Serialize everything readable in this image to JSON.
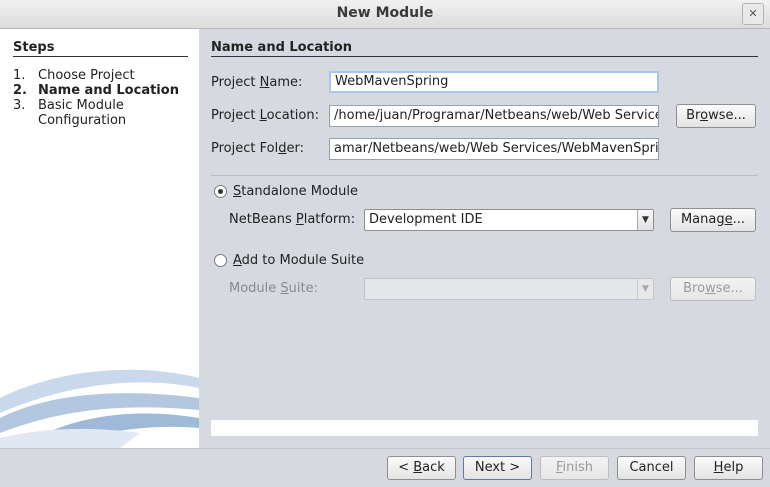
{
  "window": {
    "title": "New Module",
    "close_glyph": "✕"
  },
  "steps": {
    "title": "Steps",
    "items": [
      {
        "num": "1.",
        "label": "Choose Project"
      },
      {
        "num": "2.",
        "label": "Name and Location"
      },
      {
        "num": "3.",
        "label": "Basic Module"
      },
      {
        "num": "",
        "label": "Configuration"
      }
    ],
    "active_index": 1
  },
  "main": {
    "section_title": "Name and Location",
    "project_name": {
      "label_pre": "Project ",
      "label_key": "N",
      "label_post": "ame:",
      "value": "WebMavenSpring"
    },
    "project_location": {
      "label_pre": "Project ",
      "label_key": "L",
      "label_post": "ocation:",
      "value": "/home/juan/Programar/Netbeans/web/Web Services"
    },
    "project_folder": {
      "label_pre": "Project Fol",
      "label_key": "d",
      "label_post": "er:",
      "value": "amar/Netbeans/web/Web Services/WebMavenSpring"
    },
    "browse_button": {
      "pre": "Br",
      "key": "o",
      "post": "wse..."
    },
    "standalone": {
      "pre": "",
      "key": "S",
      "post": "tandalone Module",
      "checked": true
    },
    "platform": {
      "label_pre": "NetBeans ",
      "label_key": "P",
      "label_post": "latform:",
      "value": "Development IDE"
    },
    "manage_button": {
      "pre": "Manag",
      "key": "e",
      "post": "..."
    },
    "add_suite": {
      "pre": "",
      "key": "A",
      "post": "dd to Module Suite",
      "checked": false
    },
    "module_suite": {
      "label_pre": "Module ",
      "label_key": "S",
      "label_post": "uite:",
      "value": ""
    },
    "suite_browse_button": {
      "pre": "Bro",
      "key": "w",
      "post": "se..."
    }
  },
  "footer": {
    "back": {
      "pre": "< ",
      "key": "B",
      "post": "ack"
    },
    "next": "Next >",
    "finish": {
      "pre": "",
      "key": "F",
      "post": "inish"
    },
    "cancel": "Cancel",
    "help": {
      "pre": "",
      "key": "H",
      "post": "elp"
    }
  }
}
